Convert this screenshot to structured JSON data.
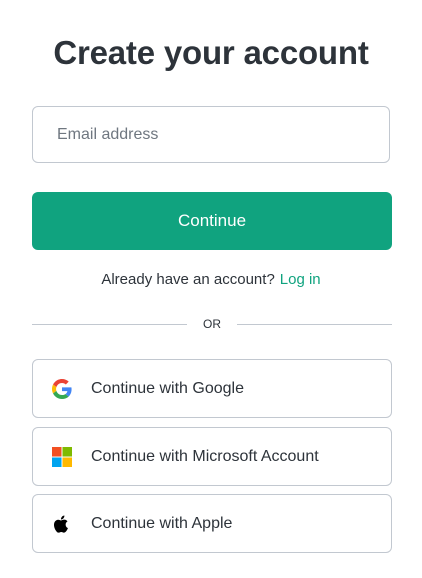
{
  "title": "Create your account",
  "email": {
    "placeholder": "Email address",
    "value": ""
  },
  "continue_label": "Continue",
  "login_prompt": {
    "text": "Already have an account?",
    "link_label": "Log in"
  },
  "divider_label": "OR",
  "social_buttons": [
    {
      "label": "Continue with Google",
      "icon": "google-icon"
    },
    {
      "label": "Continue with Microsoft Account",
      "icon": "microsoft-icon"
    },
    {
      "label": "Continue with Apple",
      "icon": "apple-icon"
    }
  ],
  "colors": {
    "accent": "#10a37f",
    "text": "#2d333a",
    "border": "#c2c8d0"
  }
}
